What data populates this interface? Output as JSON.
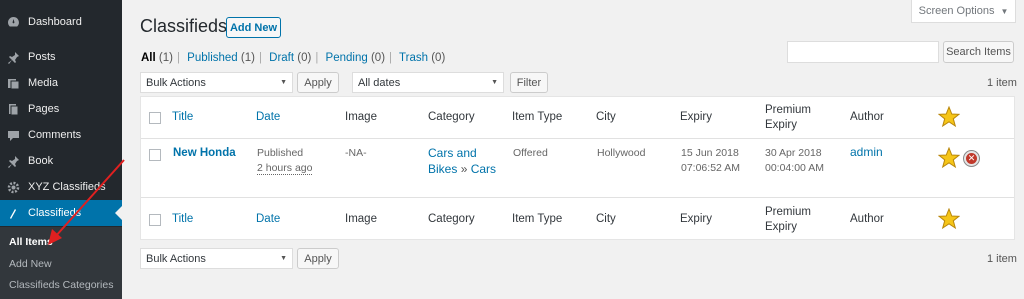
{
  "sidebar": {
    "items": [
      {
        "label": "Dashboard",
        "icon": "dashboard-icon"
      },
      {
        "label": "Posts",
        "icon": "pin-icon"
      },
      {
        "label": "Media",
        "icon": "media-icon"
      },
      {
        "label": "Pages",
        "icon": "pages-icon"
      },
      {
        "label": "Comments",
        "icon": "comment-icon"
      },
      {
        "label": "Book",
        "icon": "pin-icon"
      },
      {
        "label": "XYZ Classifieds",
        "icon": "gear-icon"
      },
      {
        "label": "Classifieds",
        "icon": "classifieds-icon"
      }
    ],
    "submenu": [
      "All Items",
      "Add New",
      "Classifieds Categories"
    ]
  },
  "header": {
    "title": "Classifieds",
    "add_new": "Add New",
    "screen_options": "Screen Options"
  },
  "filters": {
    "views": [
      {
        "label": "All",
        "count": "(1)"
      },
      {
        "label": "Published",
        "count": "(1)"
      },
      {
        "label": "Draft",
        "count": "(0)"
      },
      {
        "label": "Pending",
        "count": "(0)"
      },
      {
        "label": "Trash",
        "count": "(0)"
      }
    ],
    "search_button": "Search Items",
    "bulk_actions": "Bulk Actions",
    "apply": "Apply",
    "dates": "All dates",
    "filter": "Filter",
    "item_count": "1 item"
  },
  "table": {
    "columns": [
      "Title",
      "Date",
      "Image",
      "Category",
      "Item Type",
      "City",
      "Expiry",
      "Premium",
      "Expiry",
      "Author"
    ],
    "row": {
      "title": "New Honda",
      "status": "Published",
      "ago": "2 hours ago",
      "image": "-NA-",
      "category_1": "Cars and",
      "category_2": "Bikes",
      "category_sep": "»",
      "category_3": "Cars",
      "item_type": "Offered",
      "city": "Hollywood",
      "expiry_date": "15 Jun 2018",
      "expiry_time": "07:06:52 AM",
      "premium_date": "30 Apr 2018",
      "premium_time": "00:04:00 AM",
      "author": "admin"
    }
  },
  "colors": {
    "sidebar_bg": "#23282d",
    "active": "#0073aa",
    "link": "#0073aa",
    "arrow": "#e02020",
    "star": "#f5c518"
  }
}
